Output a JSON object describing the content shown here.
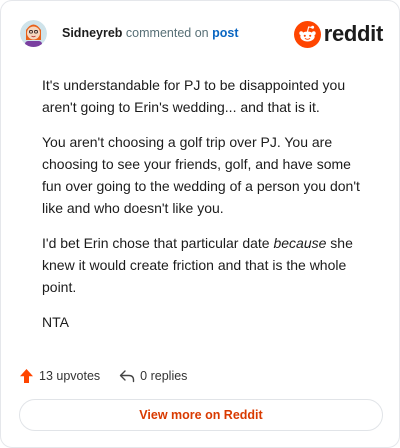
{
  "comment": {
    "username": "Sidneyreb",
    "action": "commented on",
    "post_link": "post",
    "paragraphs": {
      "p1": "It's understandable for PJ to be disappointed you aren't going to Erin's wedding... and that is it.",
      "p2": "You aren't choosing a golf trip over PJ. You are choosing to see your friends, golf, and have some fun over going to the wedding of a person you don't like and who doesn't like you.",
      "p3_before": "I'd bet Erin chose that particular date ",
      "p3_emphasis": "because",
      "p3_after": " she knew it would create friction and that is the whole point.",
      "p4": "NTA"
    }
  },
  "brand": {
    "wordmark": "reddit",
    "icon": "reddit-snoo-icon",
    "color": "#ff4500"
  },
  "footer": {
    "upvotes": "13 upvotes",
    "replies": "0 replies",
    "upvote_icon": "upvote-arrow-icon",
    "reply_icon": "reply-arrow-icon"
  },
  "cta": {
    "label": "View more on Reddit"
  },
  "colors": {
    "accent": "#ff4500",
    "link": "#0a66c2",
    "cta_text": "#d93a00"
  }
}
